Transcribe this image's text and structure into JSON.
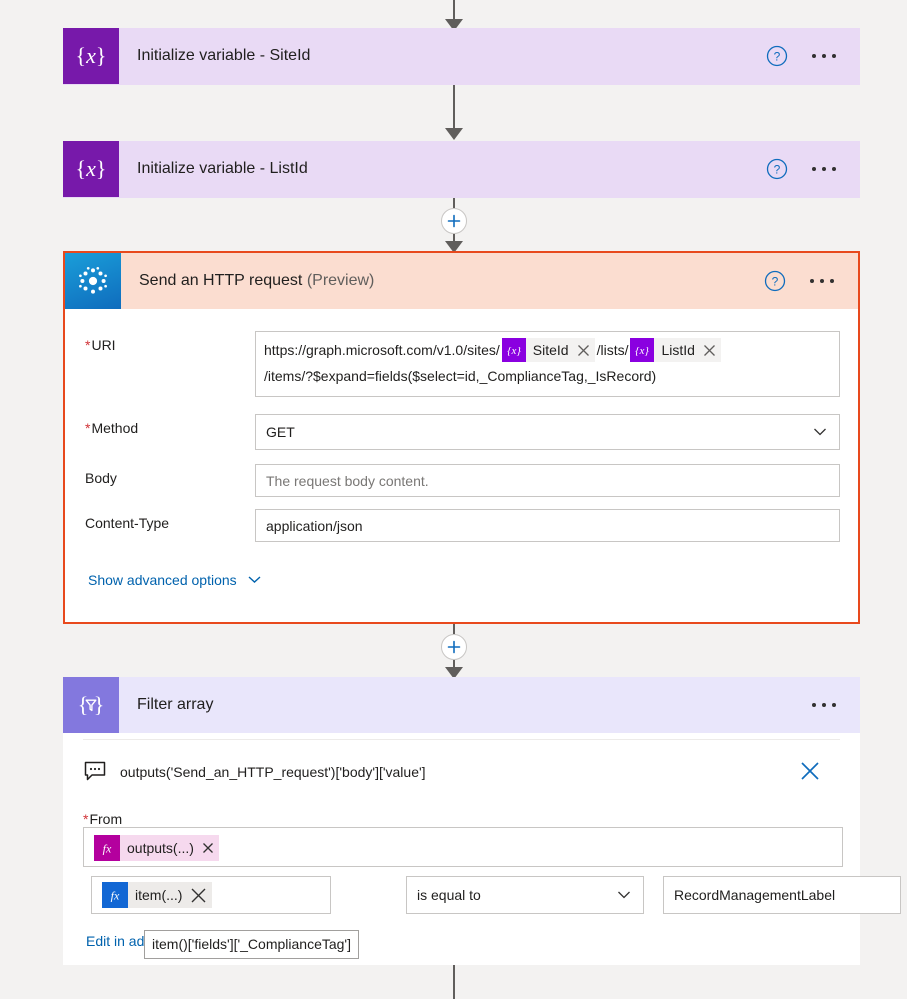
{
  "flow": {
    "steps": [
      {
        "id": "init-siteid",
        "title": "Initialize variable - SiteId",
        "icon": "variable-icon",
        "help_icon": "help-icon",
        "more_icon": "more-options-icon"
      },
      {
        "id": "init-listid",
        "title": "Initialize variable - ListId",
        "icon": "variable-icon",
        "help_icon": "help-icon",
        "more_icon": "more-options-icon"
      },
      {
        "id": "send-http",
        "title": "Send an HTTP request",
        "title_suffix": "(Preview)",
        "icon": "microsoft-graph-icon",
        "help_icon": "help-icon",
        "more_icon": "more-options-icon"
      },
      {
        "id": "filter-array",
        "title": "Filter array",
        "icon": "filter-icon",
        "more_icon": "more-options-icon"
      }
    ],
    "insert_button_label": "+"
  },
  "http_card": {
    "uri": {
      "label": "URI",
      "required_marker": "*",
      "line1_prefix": "https://graph.microsoft.com/v1.0/sites/",
      "token1": {
        "icon": "{x}",
        "label": "SiteId",
        "remove_icon": "close-icon"
      },
      "middle_text": "/lists/",
      "token2": {
        "icon": "{x}",
        "label": "ListId",
        "remove_icon": "close-icon"
      },
      "line2": "/items/?$expand=fields($select=id,_ComplianceTag,_IsRecord)"
    },
    "method": {
      "label": "Method",
      "required_marker": "*",
      "value": "GET",
      "chevron_icon": "chevron-down-icon"
    },
    "body": {
      "label": "Body",
      "placeholder": "The request body content."
    },
    "content_type": {
      "label": "Content-Type",
      "value": "application/json"
    },
    "advanced": {
      "label": "Show advanced options",
      "chevron_icon": "chevron-down-icon"
    }
  },
  "filter_card": {
    "comment": {
      "icon": "comment-icon",
      "text": "outputs('Send_an_HTTP_request')['body']['value']",
      "close_icon": "close-icon"
    },
    "from": {
      "label": "From",
      "required_marker": "*",
      "token": {
        "icon": "fx",
        "label": "outputs(...)",
        "remove_icon": "close-icon"
      }
    },
    "condition": {
      "left_token": {
        "icon": "fx",
        "label": "item(...)",
        "remove_icon": "close-icon"
      },
      "operator": "is equal to",
      "operator_chevron": "chevron-down-icon",
      "value": "RecordManagementLabel"
    },
    "advanced_link": "Edit in advanced mode",
    "tooltip": "item()['fields']['_ComplianceTag']"
  },
  "colors": {
    "variable_purple": "#7719aa",
    "variable_card_bg": "#e9daf5",
    "selection_orange": "#e8491d",
    "http_header_bg": "#fbddd0",
    "filter_purple": "#8378de",
    "filter_header_bg": "#e9e6fb",
    "link_blue": "#0062ad",
    "required_red": "#d13438",
    "token_purple": "#8a00e0",
    "token_magenta": "#b4009e",
    "token_blue": "#1267d4"
  }
}
